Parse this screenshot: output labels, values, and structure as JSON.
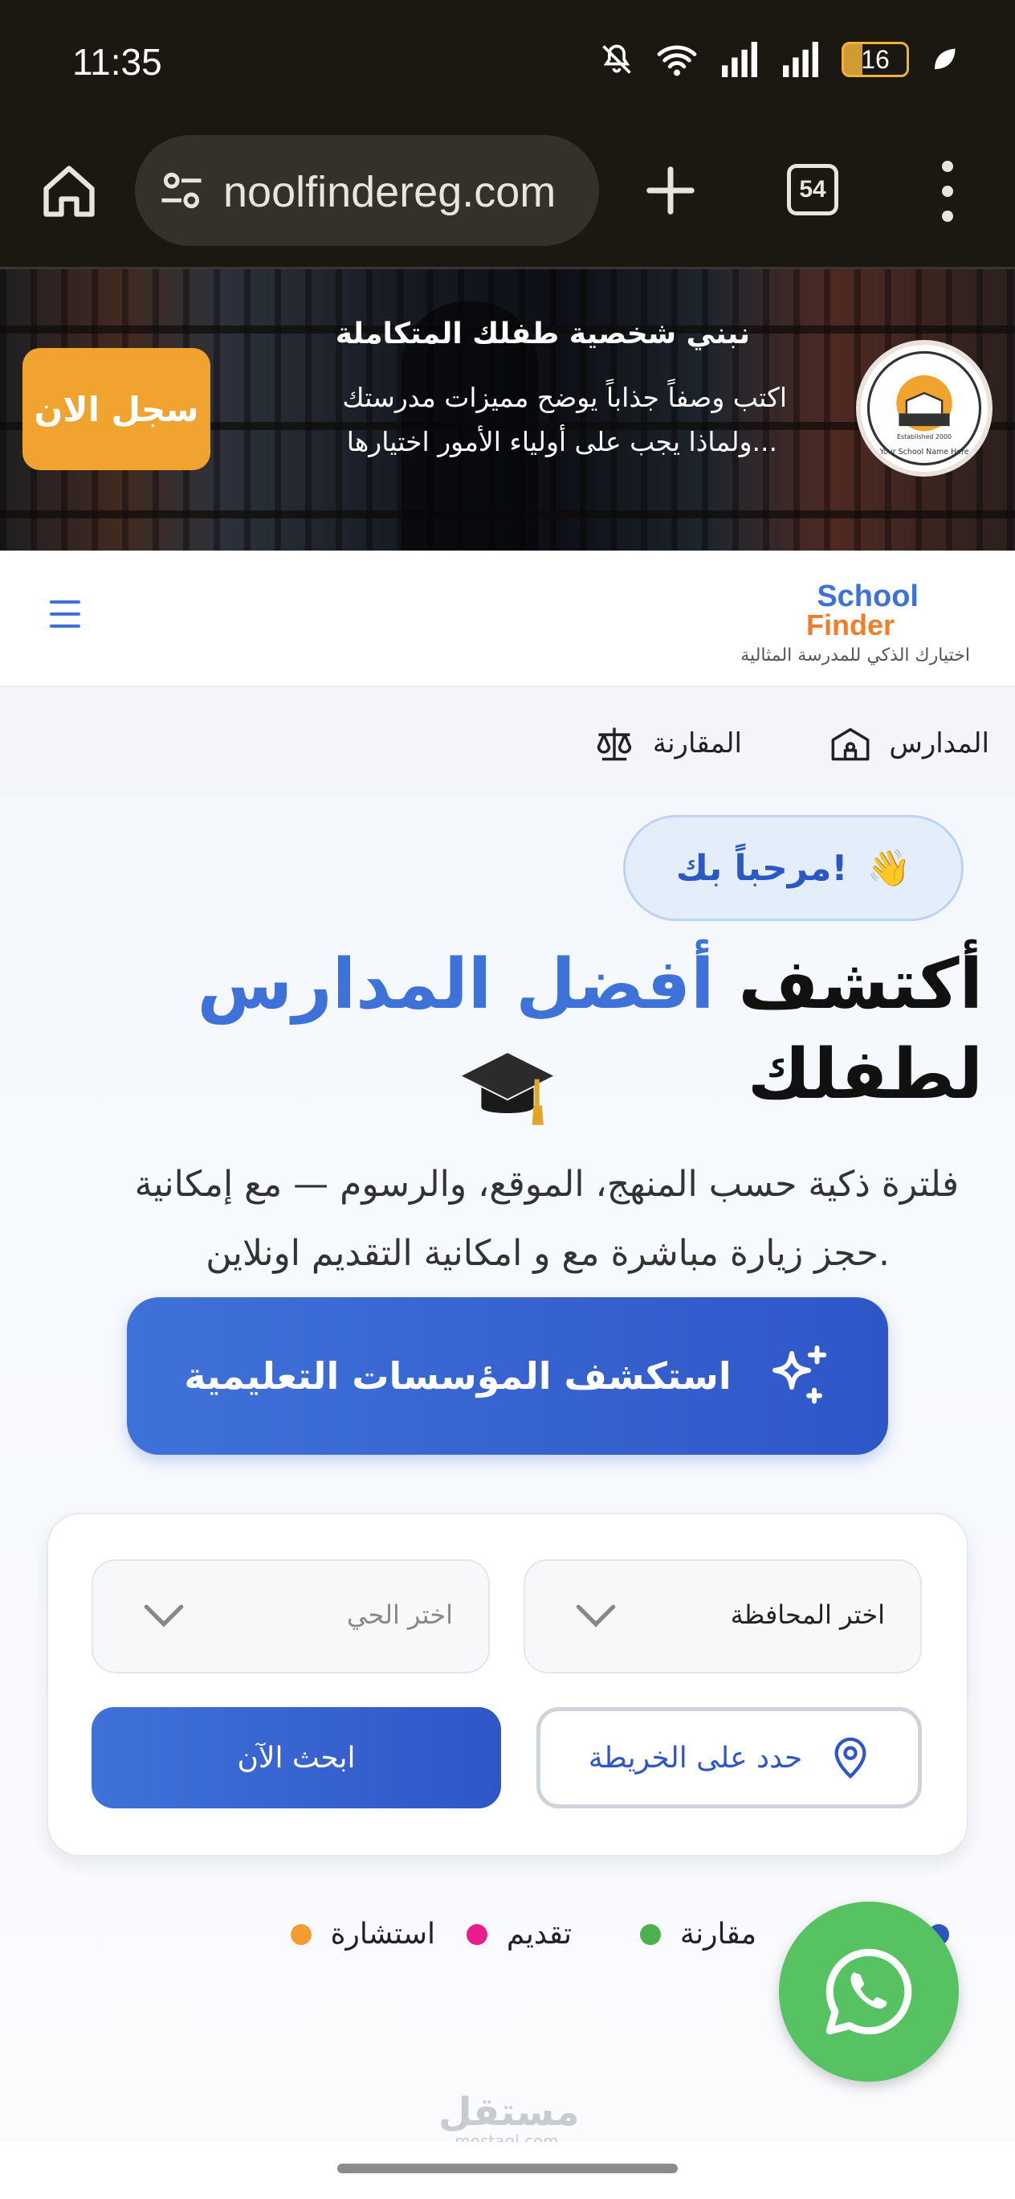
{
  "status_bar": {
    "time": "11:35",
    "battery": "16"
  },
  "browser": {
    "url": "noolfindereg.com",
    "tab_count": "54"
  },
  "banner": {
    "title": "نبني شخصية طفلك المتكاملة",
    "description_line1": "اكتب وصفاً جذاباً يوضح مميزات مدرستك",
    "description_line2": "ولماذا يجب على أولياء الأمور اختيارها...",
    "register_label": "سجل الان",
    "seal_text": "Your School Name Here",
    "seal_established": "Established 2000"
  },
  "header": {
    "logo_top": "School",
    "logo_bottom": "Finder",
    "tagline": "اختيارك الذكي للمدرسة المثالية"
  },
  "nav": {
    "schools": "المدارس",
    "comparison": "المقارنة"
  },
  "hero": {
    "welcome": "مرحباً بك!",
    "welcome_emoji": "👋",
    "title_part1": "أكتشف",
    "title_accent": "أفضل المدارس",
    "title_part2": "لطفلك",
    "subtitle_line1": "فلترة ذكية حسب المنهج، الموقع، والرسوم — مع إمكانية",
    "subtitle_line2": "حجز زيارة مباشرة مع و امكانية التقديم اونلاين.",
    "cta_label": "استكشف المؤسسات التعليمية"
  },
  "search": {
    "governorate_value": "اختر المحافظة",
    "district_placeholder": "اختر الحي",
    "map_label": "حدد على الخريطة",
    "search_label": "ابحث الآن"
  },
  "legend": [
    {
      "label": "مقارنة",
      "color": "#4caf50"
    },
    {
      "label": "تقديم",
      "color": "#e91e8c"
    },
    {
      "label": "استشارة",
      "color": "#f39c2f"
    }
  ],
  "watermark": {
    "arabic": "مستقل",
    "latin": "mostaql.com"
  },
  "colors": {
    "accent": "#3f72d8",
    "orange": "#f0a32e",
    "whatsapp": "#57c262"
  }
}
